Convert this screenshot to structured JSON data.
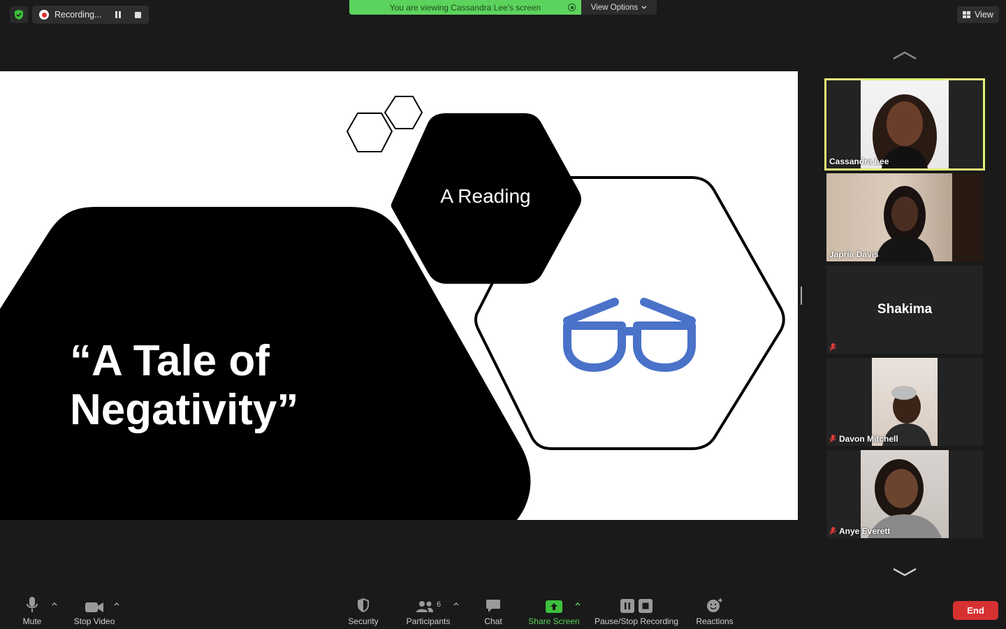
{
  "top_bar": {
    "recording_label": "Recording...",
    "banner_text": "You are viewing Cassandra Lee's screen",
    "view_options_label": "View Options",
    "view_label": "View"
  },
  "slide": {
    "title_line1": "“A Tale of",
    "title_line2": "Negativity”",
    "subtitle": "A Reading"
  },
  "participants": [
    {
      "name": "Cassandra Lee",
      "muted": false,
      "active_speaker": true,
      "video": true
    },
    {
      "name": "Japria Davis",
      "muted": false,
      "active_speaker": false,
      "video": true
    },
    {
      "name": "Shakima",
      "muted": true,
      "active_speaker": false,
      "video": false
    },
    {
      "name": "Davon Mitchell",
      "muted": true,
      "active_speaker": false,
      "video": true
    },
    {
      "name": "Anye Everett",
      "muted": true,
      "active_speaker": false,
      "video": true
    }
  ],
  "toolbar": {
    "mute_label": "Mute",
    "stop_video_label": "Stop Video",
    "security_label": "Security",
    "participants_label": "Participants",
    "participants_count": "6",
    "chat_label": "Chat",
    "share_screen_label": "Share Screen",
    "pause_stop_recording_label": "Pause/Stop Recording",
    "reactions_label": "Reactions",
    "end_label": "End"
  },
  "colors": {
    "background": "#1a1a1a",
    "banner_green": "#5cd35c",
    "active_speaker_border": "#e4f07a",
    "end_red": "#d63131",
    "share_green": "#3cc13c",
    "glasses_blue": "#4a72c9",
    "muted_red": "#e03a3a"
  }
}
